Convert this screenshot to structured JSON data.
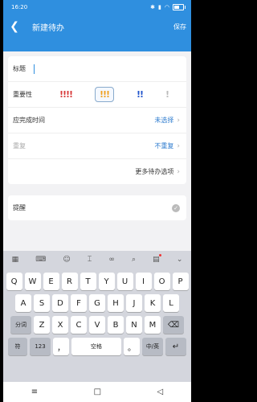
{
  "status": {
    "time": "16:20",
    "battery": "40"
  },
  "header": {
    "back_icon": "chevron-left-icon",
    "title": "新建待办",
    "save": "保存"
  },
  "form": {
    "title_label": "标题",
    "importance_label": "重要性",
    "importance": [
      {
        "text": "!!!!",
        "color": "#d83a3a"
      },
      {
        "text": "!!!",
        "color": "#f0a020"
      },
      {
        "text": "!!",
        "color": "#2255cc"
      },
      {
        "text": "!",
        "color": "#bbbbbb"
      }
    ],
    "due_label": "应完成时间",
    "due_value": "未选择",
    "repeat_label": "重复",
    "repeat_value": "不重复",
    "more_label": "更多待办选项",
    "remind_label": "提醒"
  },
  "keyboard": {
    "row1": [
      "Q",
      "W",
      "E",
      "R",
      "T",
      "Y",
      "U",
      "I",
      "O",
      "P"
    ],
    "row2": [
      "A",
      "S",
      "D",
      "F",
      "G",
      "H",
      "J",
      "K",
      "L"
    ],
    "row3": [
      "Z",
      "X",
      "C",
      "V",
      "B",
      "N",
      "M"
    ],
    "shift_label": "分词",
    "sym_label": "符",
    "num_label": "123",
    "space_label": "空格",
    "comma": "，",
    "lang_label": "中/英",
    "enter_icon": "enter-icon"
  },
  "colors": {
    "accent": "#2f8fdf",
    "value": "#2f7ccf"
  }
}
